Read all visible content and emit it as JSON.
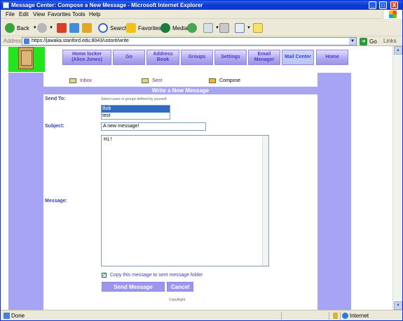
{
  "window": {
    "title": "Message Center: Compose a New Message - Microsoft Internet Explorer",
    "min": "_",
    "max": "□",
    "close": "X"
  },
  "menu": [
    "File",
    "Edit",
    "View",
    "Favorites",
    "Tools",
    "Help"
  ],
  "toolbar": {
    "back": "Back",
    "search": "Search",
    "favorites": "Favorites",
    "media": "Media"
  },
  "address": {
    "label": "Address",
    "url": "https://jawaka.stanford.edu:8043/ustorit/write",
    "go": "Go",
    "links": "Links"
  },
  "nav": {
    "items": [
      {
        "label": "Home locker\n(Alice Jones)"
      },
      {
        "label": "Go"
      },
      {
        "label": "Address\nBook"
      },
      {
        "label": "Groups"
      },
      {
        "label": "Settings"
      },
      {
        "label": "Email\nManager"
      },
      {
        "label": "Mail Center"
      },
      {
        "label": "Home"
      }
    ]
  },
  "subnav": {
    "inbox": "Inbox",
    "sent": "Sent",
    "compose": "Compose"
  },
  "form": {
    "header": "Write a New Message",
    "send_to_label": "Send To:",
    "hint": "Select users or groups defined by yourself.",
    "recipients": [
      "Bob",
      "test"
    ],
    "subject_label": "Subject:",
    "subject_value": "A new message!",
    "message_label": "Message:",
    "message_value": "Hi!",
    "copy_checkbox_label": "Copy this message to sent message folder",
    "copy_checked": true,
    "send_button": "Send Message",
    "cancel_button": "Cancel",
    "copyright": "CopyRight"
  },
  "status": {
    "text": "Done",
    "zone": "Internet"
  },
  "colors": {
    "accent": "#a8a4f5",
    "title_bar": "#0a3ad0",
    "label_text": "#3c3cb0"
  }
}
